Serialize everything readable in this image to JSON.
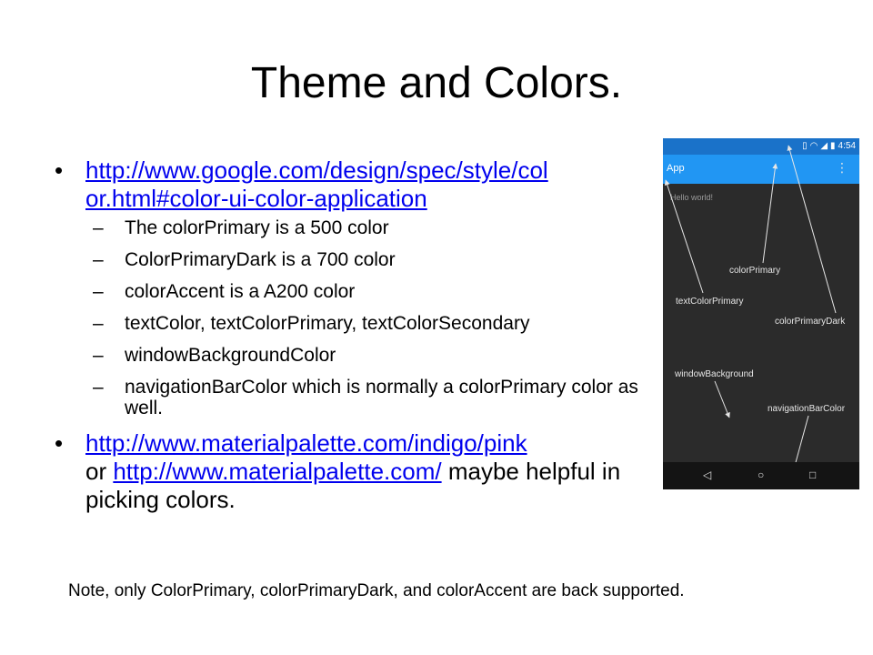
{
  "slide": {
    "title": "Theme and Colors.",
    "bullet_glyph": "•",
    "dash_glyph": "–",
    "bullet1": {
      "link": "http://www.google.com/design/spec/style/color.html#color-ui-color-application",
      "link_line1": "http://www.google.com/design/spec/style/col",
      "link_line2": "or.html#color-ui-color-application",
      "sub_items": [
        "The colorPrimary is a 500 color",
        "ColorPrimaryDark is a 700 color",
        "colorAccent is a A200 color",
        "textColor, textColorPrimary, textColorSecondary",
        "windowBackgroundColor",
        "navigationBarColor which is normally a colorPrimary color as well."
      ]
    },
    "bullet2": {
      "link1": "http://www.materialpalette.com/indigo/pink",
      "text_or": "or ",
      "link2": "http://www.materialpalette.com/",
      "text_rest": " maybe helpful in picking colors."
    },
    "note": "Note, only ColorPrimary, colorPrimaryDark, and colorAccent are back supported."
  },
  "phone": {
    "time": "4:54",
    "app_title": "App",
    "hello": "Hello world!",
    "labels": {
      "colorPrimary": "colorPrimary",
      "textColorPrimary": "textColorPrimary",
      "colorPrimaryDark": "colorPrimaryDark",
      "windowBackground": "windowBackground",
      "navigationBarColor": "navigationBarColor"
    },
    "icons": [
      "vibrate-icon",
      "wifi-icon",
      "signal-icon",
      "battery-icon",
      "overflow-menu-icon",
      "back-nav-icon",
      "home-nav-icon",
      "recents-nav-icon"
    ],
    "colors": {
      "status_bar": "#1a72c9",
      "app_bar": "#2196f3",
      "window_background": "#2b2b2b",
      "navigation_bar": "#141414"
    }
  }
}
